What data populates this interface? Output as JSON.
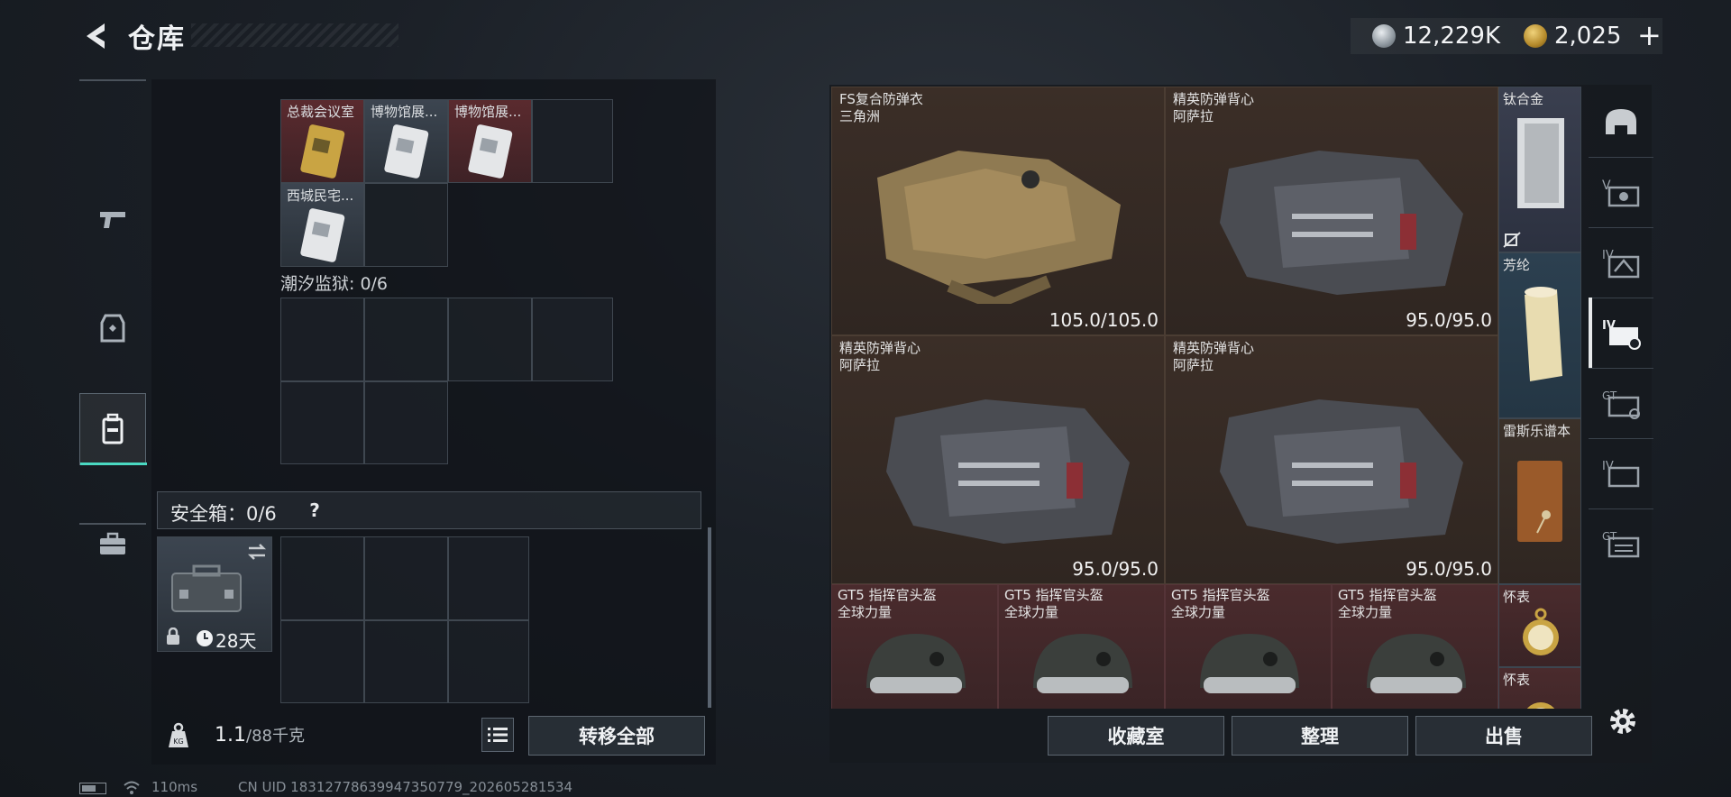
{
  "header": {
    "title": "仓库",
    "currency_silver": "12,229K",
    "currency_gold": "2,025",
    "add_label": "+"
  },
  "left_rail": {
    "items": [
      "pistol-icon",
      "loadout-icon",
      "backpack-icon",
      "briefcase-icon"
    ],
    "active_index": 2
  },
  "storage": {
    "keycards": [
      {
        "label": "总裁会议室",
        "tint": "red"
      },
      {
        "label": "博物馆展...",
        "tint": "gray"
      },
      {
        "label": "博物馆展...",
        "tint": "red"
      },
      {
        "label": "西城民宅...",
        "tint": "gray"
      }
    ],
    "prison_label": "潮汐监狱: 0/6",
    "safebox_label": "安全箱：0/6",
    "help_label": "?",
    "safebox_item": {
      "time_label": "28天"
    },
    "weight_current": "1.1",
    "weight_max": "/88千克",
    "transfer_label": "转移全部"
  },
  "inventory": {
    "armors": [
      {
        "name": "FS复合防弹衣",
        "maker": "三角洲",
        "durability": "105.0/105.0"
      },
      {
        "name": "精英防弹背心",
        "maker": "阿萨拉",
        "durability": "95.0/95.0"
      },
      {
        "name": "精英防弹背心",
        "maker": "阿萨拉",
        "durability": "95.0/95.0"
      },
      {
        "name": "精英防弹背心",
        "maker": "阿萨拉",
        "durability": "95.0/95.0"
      }
    ],
    "helmets": [
      {
        "name": "GT5 指挥官头盔",
        "maker": "全球力量"
      },
      {
        "name": "GT5 指挥官头盔",
        "maker": "全球力量"
      },
      {
        "name": "GT5 指挥官头盔",
        "maker": "全球力量"
      },
      {
        "name": "GT5 指挥官头盔",
        "maker": "全球力量"
      }
    ],
    "side_items": [
      {
        "name": "钛合金"
      },
      {
        "name": "芳纶"
      },
      {
        "name": "雷斯乐谱本"
      },
      {
        "name": "怀表"
      },
      {
        "name": "怀表"
      }
    ],
    "actions": {
      "collection": "收藏室",
      "sort": "整理",
      "sell": "出售"
    }
  },
  "right_rail": {
    "items": [
      "helmet-slot-icon",
      "chest-rig-v-icon",
      "armor-iv-icon",
      "armor-iv-active-icon",
      "gti-icon",
      "iv-icon",
      "gtii-icon"
    ]
  },
  "footer": {
    "ping": "110ms",
    "uid": "CN UID 18312778639947350779_202605281534"
  }
}
